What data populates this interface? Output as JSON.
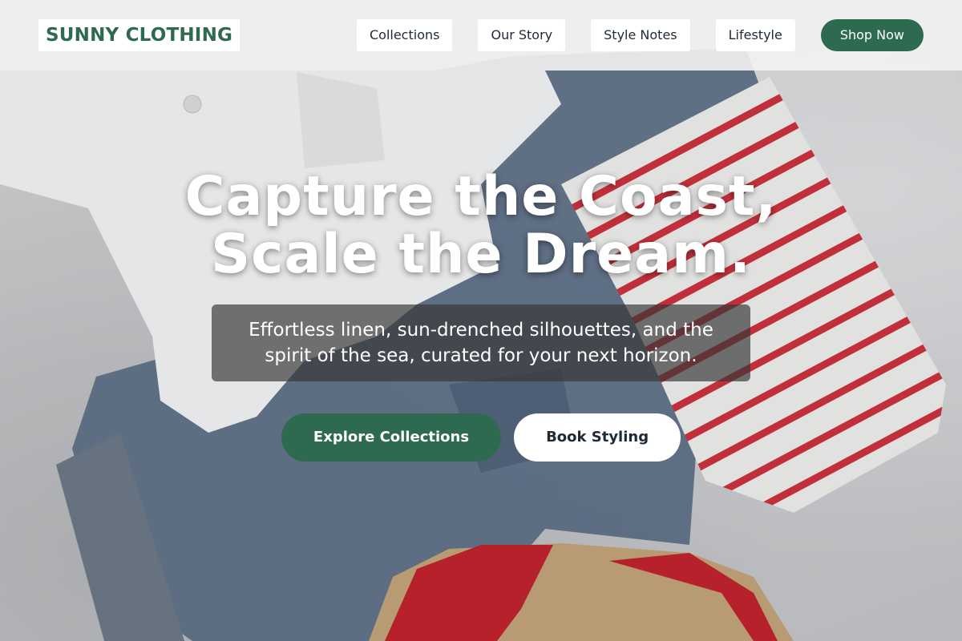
{
  "brand": {
    "name": "SUNNY CLOTHING"
  },
  "nav": {
    "links": [
      "Collections",
      "Our Story",
      "Style Notes",
      "Lifestyle"
    ],
    "cta": "Shop Now"
  },
  "hero": {
    "title_line1": "Capture the Coast,",
    "title_line2": "Scale the Dream.",
    "subtitle_line1": "Effortless linen, sun-drenched silhouettes, and the",
    "subtitle_line2": "spirit of the sea, curated for your next horizon.",
    "primary_button": "Explore Collections",
    "secondary_button": "Book Styling",
    "background_image": "flat-lay of white shirt, denim jeans, striped tee and red sandal"
  },
  "colors": {
    "brand_green": "#2d6a4f",
    "nav_background": "#f2f2f2",
    "text_dark": "#1f2a36",
    "white": "#ffffff"
  }
}
